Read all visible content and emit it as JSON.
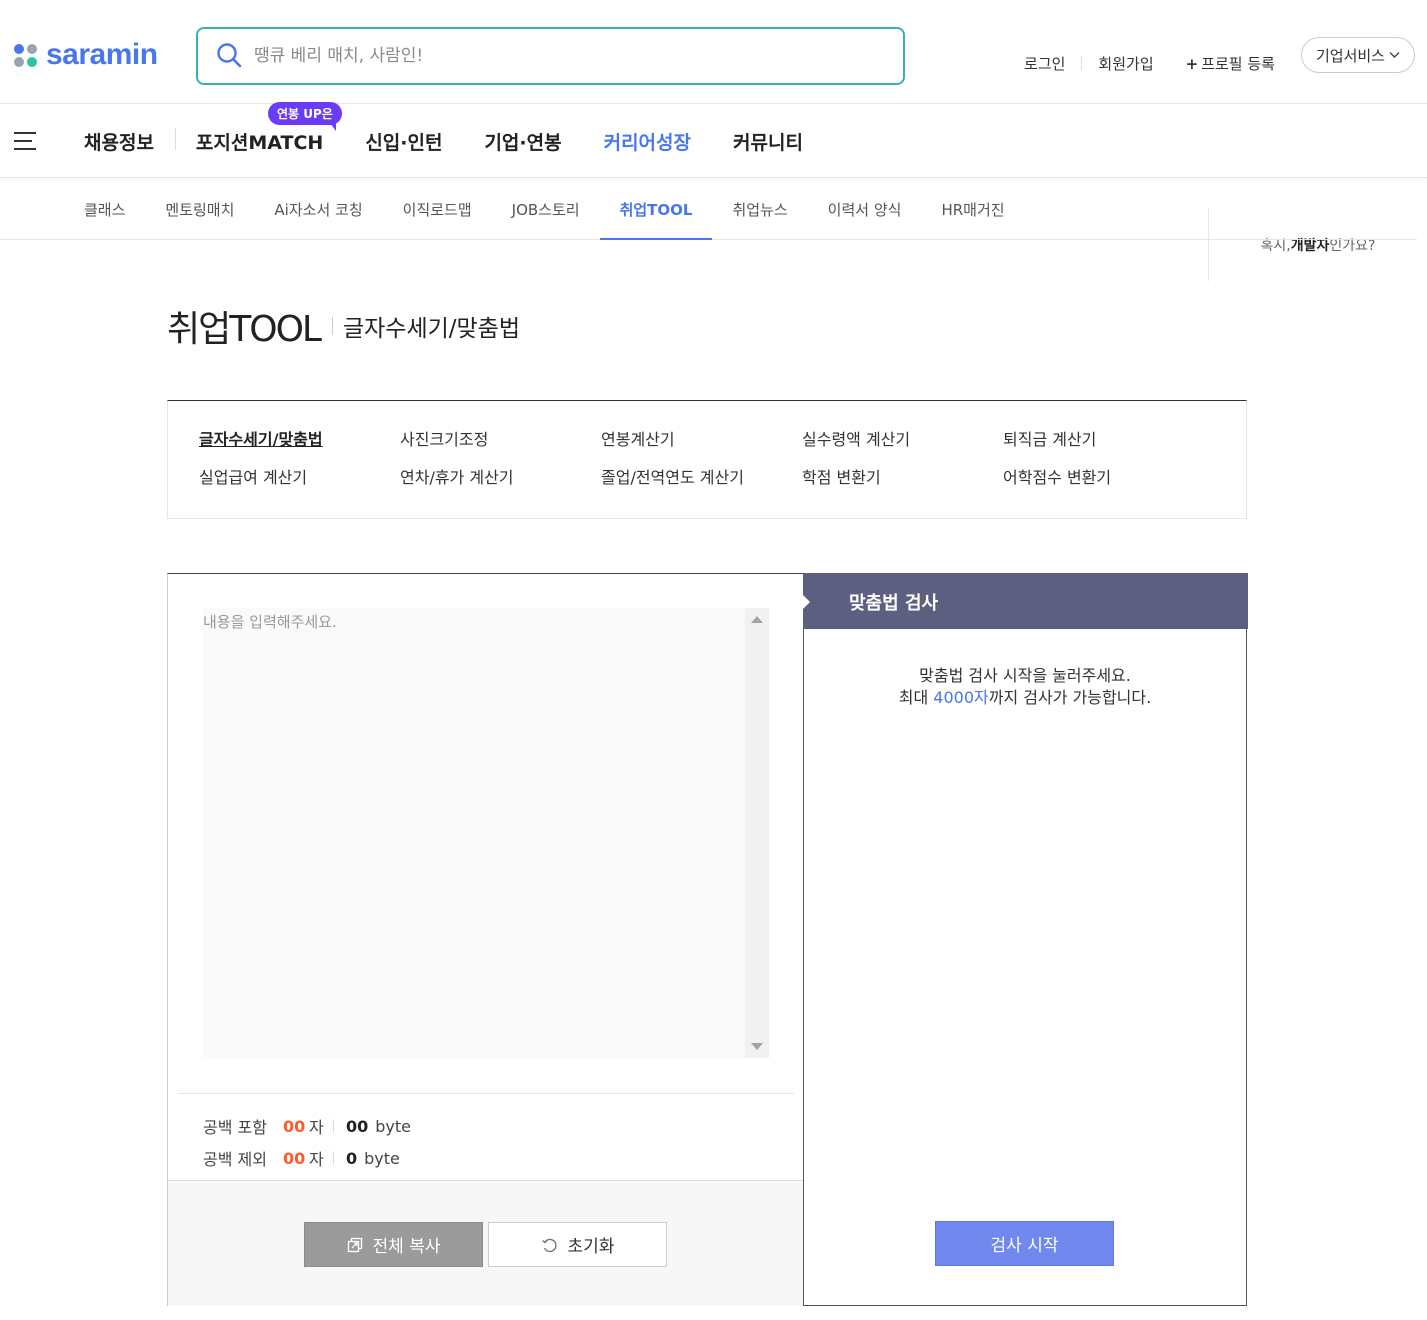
{
  "header": {
    "logo_text": "saramin",
    "search_placeholder": "땡큐 베리 매치, 사람인!",
    "links": {
      "login": "로그인",
      "signup": "회원가입",
      "profile_plus": "+",
      "profile": "프로필 등록",
      "business": "기업서비스"
    }
  },
  "gnb": {
    "items": [
      "채용정보",
      "포지션MATCH",
      "신입·인턴",
      "기업·연봉",
      "커리어성장",
      "커뮤니티"
    ],
    "badge": "연봉 UP은",
    "dev_prefix": "혹시,",
    "dev_bold": "개발자",
    "dev_suffix": "인가요?"
  },
  "lnb": {
    "items": [
      "클래스",
      "멘토링매치",
      "Ai자소서 코칭",
      "이직로드맵",
      "JOB스토리",
      "취업TOOL",
      "취업뉴스",
      "이력서 양식",
      "HR매거진"
    ]
  },
  "page": {
    "title": "취업TOOL",
    "subtitle": "글자수세기/맞춤법"
  },
  "tools": {
    "items": [
      "글자수세기/맞춤법",
      "사진크기조정",
      "연봉계산기",
      "실수령액 계산기",
      "퇴직금 계산기",
      "실업급여 계산기",
      "연차/휴가 계산기",
      "졸업/전역연도 계산기",
      "학점 변환기",
      "어학점수 변환기"
    ]
  },
  "editor": {
    "placeholder": "내용을 입력해주세요.",
    "with_space_label": "공백 포함",
    "with_space_chars": "00",
    "with_space_bytes": "00",
    "without_space_label": "공백 제외",
    "without_space_chars": "00",
    "without_space_bytes": "0",
    "char_unit": "자",
    "byte_unit": "byte",
    "copy_button": "전체 복사",
    "reset_button": "초기화"
  },
  "spell": {
    "heading": "맞춤법 검사",
    "msg_line1": "맞춤법 검사 시작을 눌러주세요.",
    "msg_pre": "최대 ",
    "msg_limit": "4000자",
    "msg_post": "까지 검사가 가능합니다.",
    "check_button": "검사 시작"
  },
  "colors": {
    "brand_blue": "#4876ef",
    "brand_green": "#29c4a3",
    "count_orange": "#ff5a2a",
    "panel_header": "#5c5f80",
    "check_button": "#7189ee"
  }
}
